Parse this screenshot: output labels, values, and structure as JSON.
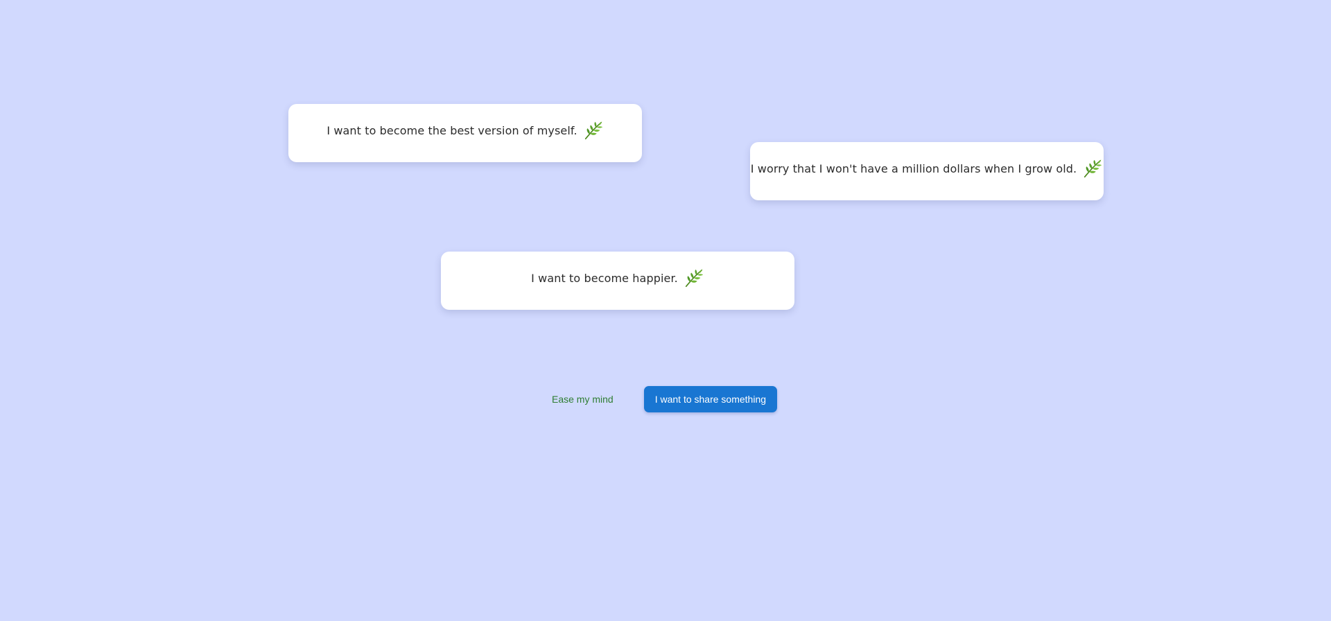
{
  "cards": [
    {
      "text": "I want to become the best version of myself.",
      "icon": "leaf-icon"
    },
    {
      "text": "I worry that I won't have a million dollars when I grow old.",
      "icon": "leaf-icon"
    },
    {
      "text": "I want to become happier.",
      "icon": "leaf-icon"
    }
  ],
  "actions": {
    "ease_label": "Ease my mind",
    "share_label": "I want to share something"
  },
  "colors": {
    "background": "#d1d9fe",
    "card": "#ffffff",
    "accent_green": "#2e7d32",
    "primary_blue": "#1976d2"
  }
}
